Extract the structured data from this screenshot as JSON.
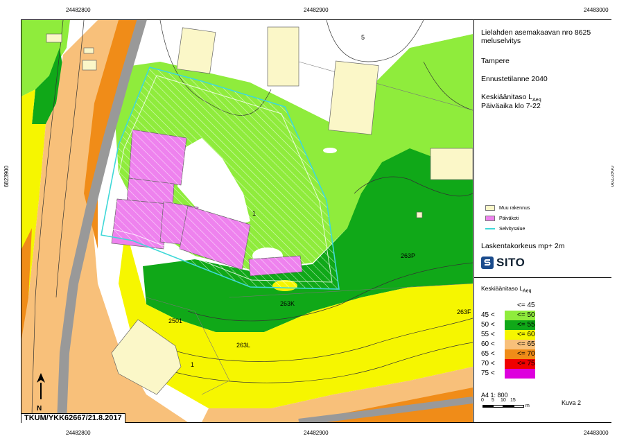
{
  "coords": {
    "top": [
      "24482800",
      "24482900",
      "24483000"
    ],
    "bottom": [
      "24482800",
      "24482900",
      "24483000"
    ],
    "left": "6823900",
    "right": "6823900"
  },
  "title": {
    "line1": "Lielahden asemakaavan nro 8625",
    "line2": "meluselvitys",
    "place": "Tampere",
    "scenario": "Ennustetilanne 2040",
    "metric": "Keskiäänitaso L",
    "metric_sub": "Aeq",
    "period": "Päiväaika klo 7-22"
  },
  "legend_symbols": [
    {
      "label": "Muu rakennus",
      "color": "#fbf7c8",
      "kind": "box"
    },
    {
      "label": "Päiväkoti",
      "color": "#ee82ee",
      "kind": "box"
    },
    {
      "label": "Selvitysalue",
      "color": "#3fd8d8",
      "kind": "line"
    }
  ],
  "calc_height": "Laskentakorkeus mp+ 2m",
  "logo_text": "SITO",
  "classes_title": "Keskiäänitaso L",
  "classes_title_sub": "Aeq",
  "classes": [
    {
      "lo": "",
      "hi": "<= 45",
      "color": "#ffffff"
    },
    {
      "lo": "45 <",
      "hi": "<= 50",
      "color": "#8fec3c"
    },
    {
      "lo": "50 <",
      "hi": "<= 55",
      "color": "#10a818"
    },
    {
      "lo": "55 <",
      "hi": "<= 60",
      "color": "#f6f600"
    },
    {
      "lo": "60 <",
      "hi": "<= 65",
      "color": "#f8c07a"
    },
    {
      "lo": "65 <",
      "hi": "<= 70",
      "color": "#f08c18"
    },
    {
      "lo": "70 <",
      "hi": "<= 75",
      "color": "#f00000"
    },
    {
      "lo": "75 <",
      "hi": "",
      "color": "#dd00dd"
    }
  ],
  "scale": {
    "label": "A4 1: 800",
    "ticks": [
      "0",
      "5",
      "10",
      "15"
    ],
    "unit": "m"
  },
  "figure_no": "Kuva 2",
  "map_labels": {
    "n5": "5",
    "n1": "1",
    "n1b": "1",
    "l263P": "263P",
    "l263K": "263K",
    "l263L": "263L",
    "l2501": "2501",
    "l263F": "263F"
  },
  "stamp": "TKUM/YKK62667/21.8.2017",
  "north": "N"
}
